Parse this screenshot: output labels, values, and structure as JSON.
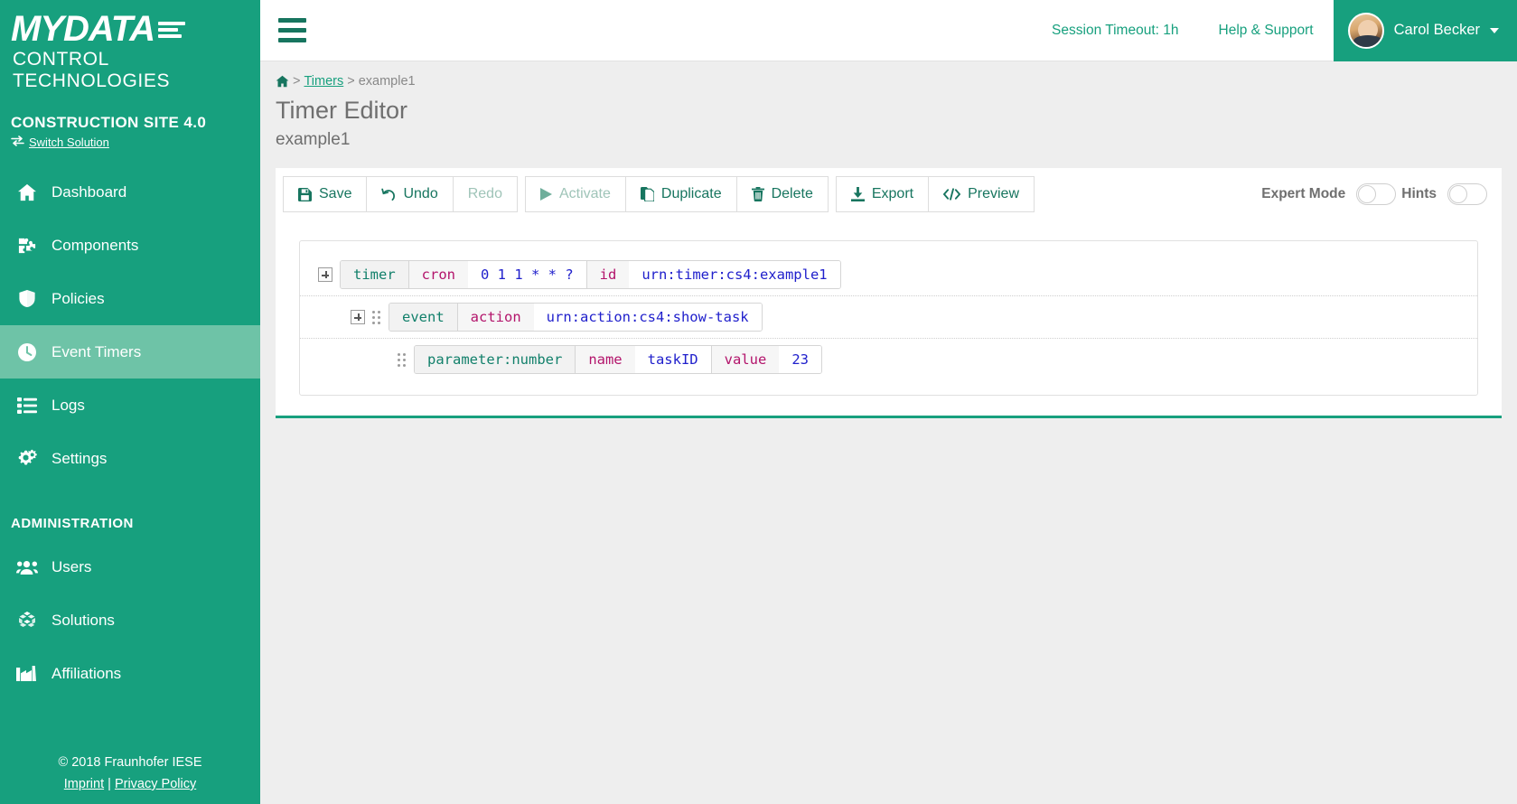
{
  "brand": {
    "logo_main": "MYDATA",
    "logo_sub": "CONTROL TECHNOLOGIES",
    "solution_title": "CONSTRUCTION SITE 4.0",
    "switch_solution": "Switch Solution",
    "switch_icon": "exchange-icon"
  },
  "sidebar": {
    "items": [
      {
        "label": "Dashboard",
        "icon": "home-icon",
        "active": false
      },
      {
        "label": "Components",
        "icon": "puzzle-icon",
        "active": false
      },
      {
        "label": "Policies",
        "icon": "shield-icon",
        "active": false
      },
      {
        "label": "Event Timers",
        "icon": "clock-icon",
        "active": true
      },
      {
        "label": "Logs",
        "icon": "list-icon",
        "active": false
      },
      {
        "label": "Settings",
        "icon": "gears-icon",
        "active": false
      }
    ],
    "admin_heading": "ADMINISTRATION",
    "admin_items": [
      {
        "label": "Users",
        "icon": "users-icon",
        "active": false
      },
      {
        "label": "Solutions",
        "icon": "cubes-icon",
        "active": false
      },
      {
        "label": "Affiliations",
        "icon": "factory-icon",
        "active": false
      }
    ],
    "footer": {
      "copyright": "© 2018 Fraunhofer IESE",
      "imprint": "Imprint",
      "divider": "|",
      "privacy": "Privacy Policy"
    }
  },
  "topbar": {
    "menu_icon": "hamburger-icon",
    "session_timeout": "Session Timeout: 1h",
    "help_support": "Help & Support",
    "user_name": "Carol Becker",
    "avatar_icon": "user-avatar",
    "caret_icon": "chevron-down-icon"
  },
  "breadcrumb": {
    "home_icon": "home-icon",
    "sep1": ">",
    "link": "Timers",
    "sep2": ">",
    "current": "example1"
  },
  "page": {
    "title": "Timer Editor",
    "subtitle": "example1"
  },
  "toolbar": {
    "buttons": [
      {
        "label": "Save",
        "icon": "save-icon",
        "disabled": false
      },
      {
        "label": "Undo",
        "icon": "undo-icon",
        "disabled": false
      },
      {
        "label": "Redo",
        "icon": "redo-icon",
        "disabled": true
      },
      {
        "label": "Activate",
        "icon": "play-icon",
        "disabled": true
      },
      {
        "label": "Duplicate",
        "icon": "copy-icon",
        "disabled": false
      },
      {
        "label": "Delete",
        "icon": "trash-icon",
        "disabled": false
      },
      {
        "label": "Export",
        "icon": "download-icon",
        "disabled": false
      },
      {
        "label": "Preview",
        "icon": "code-icon",
        "disabled": false
      }
    ],
    "expert_mode_label": "Expert Mode",
    "expert_mode_on": false,
    "hints_label": "Hints",
    "hints_on": false
  },
  "editor": {
    "rows": [
      {
        "id": "row-timer",
        "expander": true,
        "grip": false,
        "indent": 0,
        "tokens": [
          {
            "text": "timer",
            "type": "tag"
          },
          {
            "text": "cron",
            "type": "key"
          },
          {
            "text": "0 1 1 * * ?",
            "type": "val"
          },
          {
            "text": "id",
            "type": "key"
          },
          {
            "text": "urn:timer:cs4:example1",
            "type": "val"
          }
        ]
      },
      {
        "id": "row-event",
        "expander": true,
        "grip": true,
        "indent": 36,
        "tokens": [
          {
            "text": "event",
            "type": "tag"
          },
          {
            "text": "action",
            "type": "key"
          },
          {
            "text": "urn:action:cs4:show-task",
            "type": "val"
          }
        ]
      },
      {
        "id": "row-parameter",
        "expander": false,
        "grip": true,
        "indent": 88,
        "tokens": [
          {
            "text": "parameter:number",
            "type": "tag"
          },
          {
            "text": "name",
            "type": "key"
          },
          {
            "text": "taskID",
            "type": "val"
          },
          {
            "text": "value",
            "type": "key"
          },
          {
            "text": "23",
            "type": "val"
          }
        ]
      }
    ]
  },
  "colors": {
    "brand_green": "#17a07e",
    "brand_green_dark": "#17755f",
    "active_nav": "#6ec3a7",
    "tag_token": "#12806b",
    "key_token": "#b3146b",
    "value_token": "#2020cc",
    "page_bg": "#eeeeee"
  }
}
